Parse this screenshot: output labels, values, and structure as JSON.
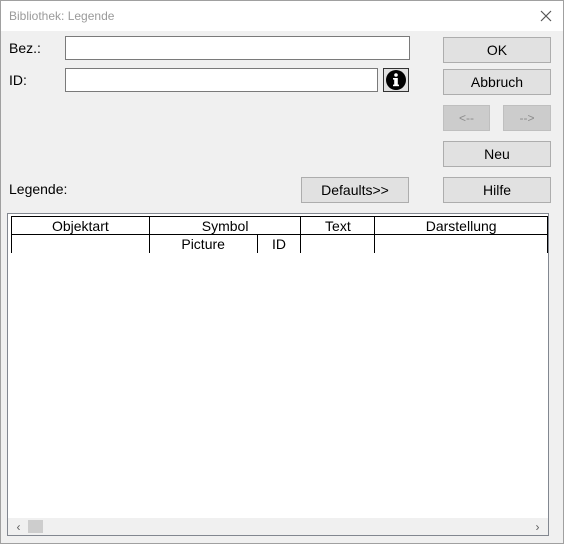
{
  "window": {
    "title": "Bibliothek: Legende",
    "close_glyph": "✕"
  },
  "form": {
    "bez_label": "Bez.:",
    "bez_value": "",
    "id_label": "ID:",
    "id_value": "",
    "info_icon": "info-icon",
    "legende_label": "Legende:"
  },
  "buttons": {
    "ok": "OK",
    "abbruch": "Abbruch",
    "prev": "<--",
    "next": "-->",
    "neu": "Neu",
    "hilfe": "Hilfe",
    "defaults": "Defaults>>"
  },
  "table": {
    "headers": [
      "Objektart",
      "Symbol",
      "Text",
      "Darstellung"
    ],
    "subheaders": {
      "picture": "Picture",
      "id": "ID"
    }
  },
  "scrollbar": {
    "left_arrow": "‹",
    "right_arrow": "›"
  }
}
